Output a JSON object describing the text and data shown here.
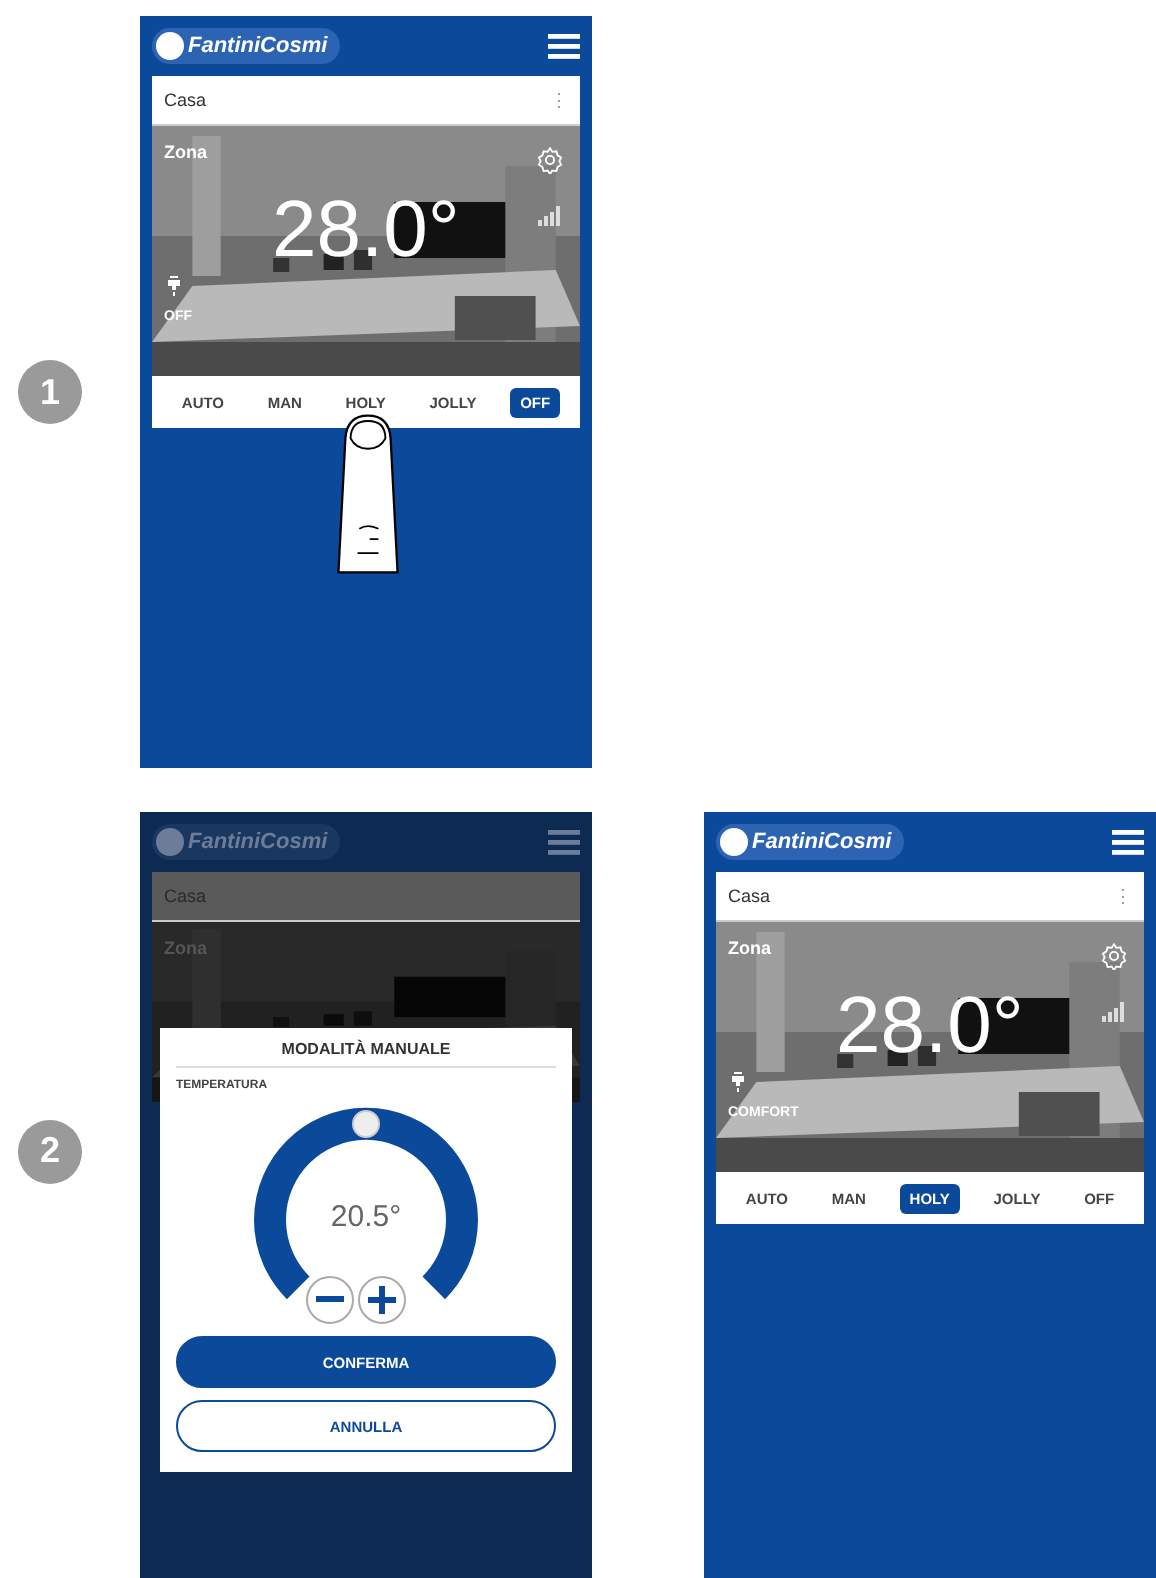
{
  "step_badges": [
    "1",
    "2"
  ],
  "screens": [
    {
      "kind": "home",
      "logo": "FantiniCosmi",
      "location": "Casa",
      "more_icon": "⋮",
      "zone": "Zona",
      "temperature": "28.0°",
      "status": "OFF",
      "tap_hint": true,
      "modes": [
        {
          "label": "AUTO",
          "selected": false
        },
        {
          "label": "MAN",
          "selected": false
        },
        {
          "label": "HOLY",
          "selected": false
        },
        {
          "label": "JOLLY",
          "selected": false
        },
        {
          "label": "OFF",
          "selected": true
        }
      ]
    },
    {
      "kind": "dialog",
      "logo": "FantiniCosmi",
      "location": "Casa",
      "zone": "Zona",
      "dialog": {
        "title": "MODALITÀ MANUALE",
        "field_label": "TEMPERATURA",
        "value": "20.5°",
        "confirm": "CONFERMA",
        "cancel": "ANNULLA"
      }
    },
    {
      "kind": "home",
      "logo": "FantiniCosmi",
      "location": "Casa",
      "more_icon": "⋮",
      "zone": "Zona",
      "temperature": "28.0°",
      "status": "COMFORT",
      "tap_hint": false,
      "modes": [
        {
          "label": "AUTO",
          "selected": false
        },
        {
          "label": "MAN",
          "selected": false
        },
        {
          "label": "HOLY",
          "selected": true
        },
        {
          "label": "JOLLY",
          "selected": false
        },
        {
          "label": "OFF",
          "selected": false
        }
      ]
    }
  ]
}
